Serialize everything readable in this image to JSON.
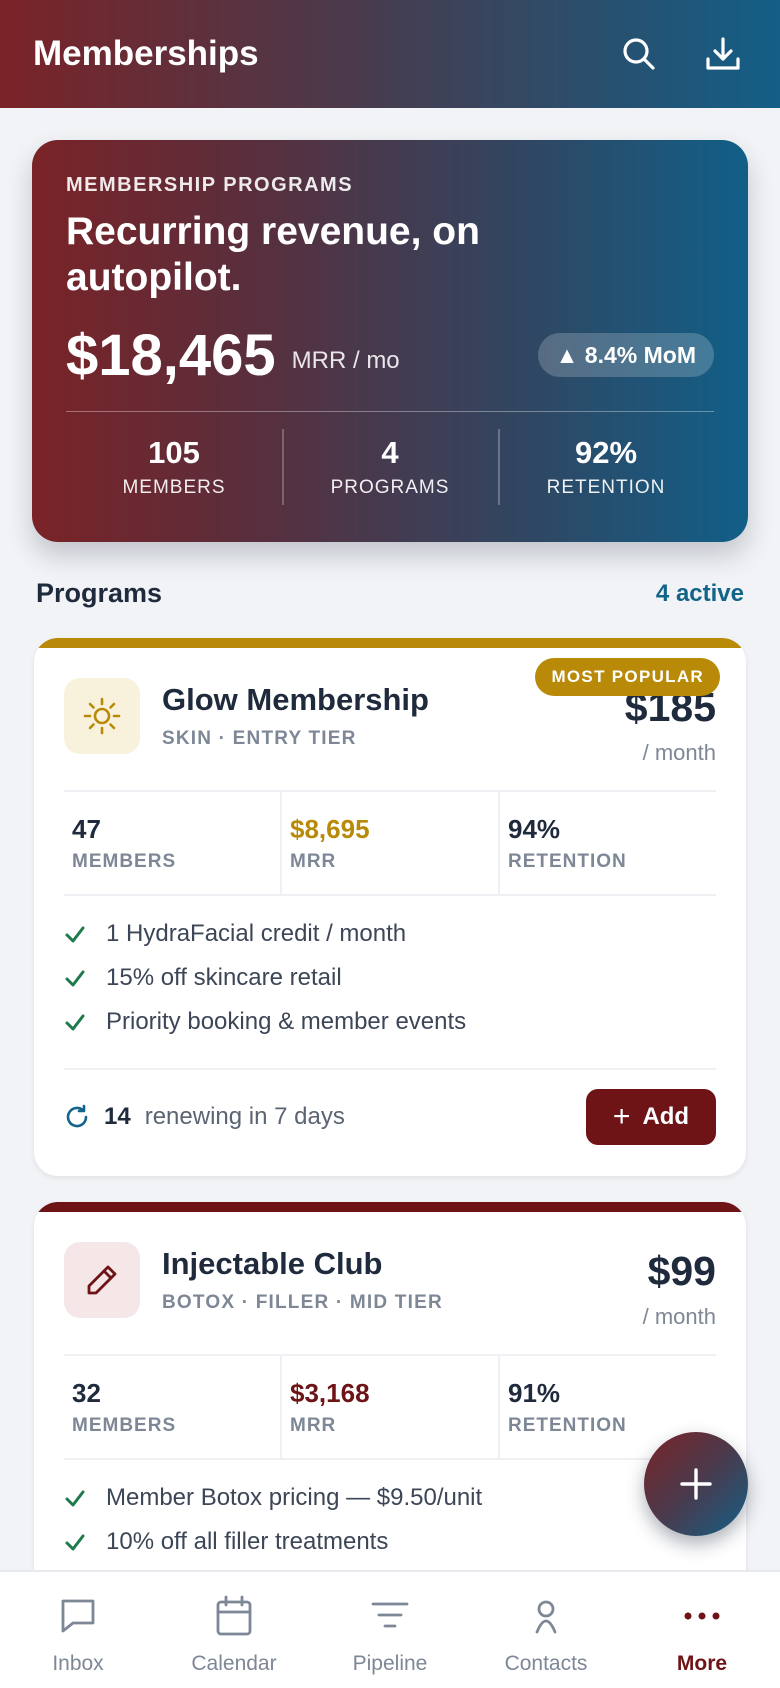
{
  "header": {
    "title": "Memberships",
    "search_icon": "search-icon",
    "download_icon": "download-icon"
  },
  "hero": {
    "eyebrow": "MEMBERSHIP PROGRAMS",
    "headline": "Recurring revenue, on autopilot.",
    "mrr_value": "$18,465",
    "mrr_unit": "MRR / mo",
    "mom": "▲ 8.4% MoM",
    "stats": [
      {
        "value": "105",
        "label": "MEMBERS"
      },
      {
        "value": "4",
        "label": "PROGRAMS"
      },
      {
        "value": "92%",
        "label": "RETENTION"
      }
    ]
  },
  "programs_section": {
    "title": "Programs",
    "active_count": "4 active"
  },
  "programs": [
    {
      "name": "Glow Membership",
      "subtitle": "SKIN · ENTRY TIER",
      "price": "$185",
      "per": "/ month",
      "badge": "MOST POPULAR",
      "icon": "sun-icon",
      "accent": "#b88a08",
      "metrics": [
        {
          "value": "47",
          "label": "MEMBERS"
        },
        {
          "value": "$8,695",
          "label": "MRR"
        },
        {
          "value": "94%",
          "label": "RETENTION"
        }
      ],
      "perks": [
        "1 HydraFacial credit / month",
        "15% off skincare retail",
        "Priority booking & member events"
      ],
      "renew_count": "14",
      "renew_text": "renewing in 7 days",
      "add_label": "Add",
      "add_plus": "+"
    },
    {
      "name": "Injectable Club",
      "subtitle": "BOTOX · FILLER · MID TIER",
      "price": "$99",
      "per": "/ month",
      "icon": "pencil-icon",
      "accent": "#6e1316",
      "metrics": [
        {
          "value": "32",
          "label": "MEMBERS"
        },
        {
          "value": "$3,168",
          "label": "MRR"
        },
        {
          "value": "91%",
          "label": "RETENTION"
        }
      ],
      "perks": [
        "Member Botox pricing — $9.50/unit",
        "10% off all filler treatments"
      ]
    }
  ],
  "fab": {
    "icon": "plus-icon"
  },
  "tabs": [
    {
      "label": "Inbox",
      "icon": "chat-icon"
    },
    {
      "label": "Calendar",
      "icon": "calendar-icon"
    },
    {
      "label": "Pipeline",
      "icon": "filter-icon"
    },
    {
      "label": "Contacts",
      "icon": "person-icon"
    },
    {
      "label": "More",
      "icon": "more-icon",
      "active": true
    }
  ],
  "colors": {
    "brand_maroon": "#6e1316",
    "brand_blue": "#136489",
    "gold": "#b88a08",
    "check_green": "#1e7a4c"
  }
}
